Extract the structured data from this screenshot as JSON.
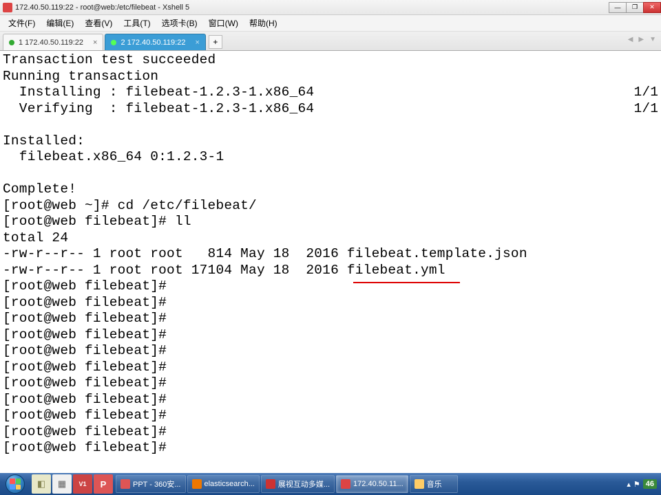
{
  "window": {
    "title": "172.40.50.119:22 - root@web:/etc/filebeat - Xshell 5"
  },
  "menu": {
    "file": "文件(F)",
    "edit": "编辑(E)",
    "view": "查看(V)",
    "tools": "工具(T)",
    "tabs": "选项卡(B)",
    "window": "窗口(W)",
    "help": "帮助(H)"
  },
  "tabs": {
    "tab1": "1 172.40.50.119:22",
    "tab2": "2 172.40.50.119:22",
    "add": "+"
  },
  "terminal": {
    "lines": [
      "Transaction test succeeded",
      "Running transaction",
      "  Installing : filebeat-1.2.3-1.x86_64                                       1/1",
      "  Verifying  : filebeat-1.2.3-1.x86_64                                       1/1",
      "",
      "Installed:",
      "  filebeat.x86_64 0:1.2.3-1",
      "",
      "Complete!",
      "[root@web ~]# cd /etc/filebeat/",
      "[root@web filebeat]# ll",
      "total 24",
      "-rw-r--r-- 1 root root   814 May 18  2016 filebeat.template.json",
      "-rw-r--r-- 1 root root 17104 May 18  2016 filebeat.yml",
      "[root@web filebeat]# ",
      "[root@web filebeat]# ",
      "[root@web filebeat]# ",
      "[root@web filebeat]# ",
      "[root@web filebeat]# ",
      "[root@web filebeat]# ",
      "[root@web filebeat]# ",
      "[root@web filebeat]# ",
      "[root@web filebeat]# ",
      "[root@web filebeat]# ",
      "[root@web filebeat]# "
    ]
  },
  "taskbar": {
    "items": {
      "ppt": "PPT - 360安...",
      "firefox": "elasticsearch...",
      "video": "展视互动多媒...",
      "xshell": "172.40.50.11...",
      "music": "音乐"
    },
    "tray": {
      "flag": "⚑",
      "badge": "46"
    }
  },
  "icons": {
    "ppt_letter": "P",
    "vnc_letter": "V1"
  }
}
